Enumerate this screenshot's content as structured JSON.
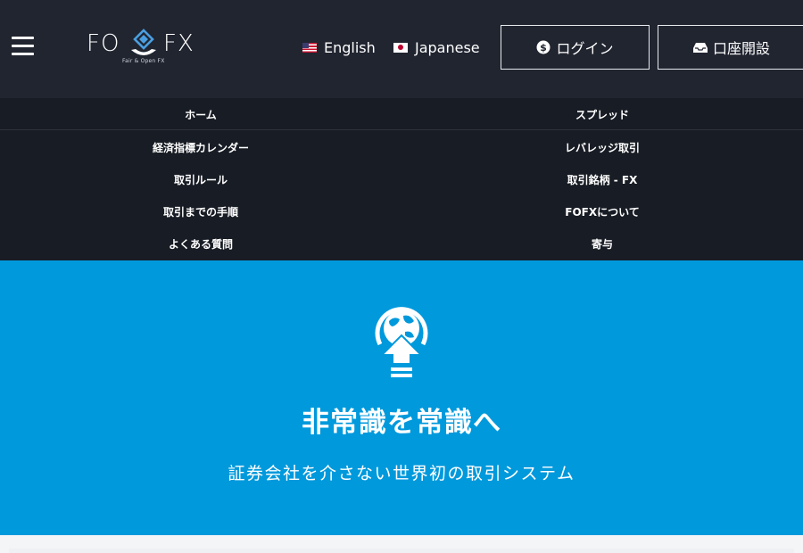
{
  "header": {
    "logo": {
      "left": "FO",
      "right": "FX",
      "tagline": "Fair & Open FX"
    },
    "languages": [
      {
        "label": "English",
        "flag": "us-flag-icon"
      },
      {
        "label": "Japanese",
        "flag": "jp-flag-icon"
      }
    ],
    "login_label": "ログイン",
    "open_account_label": "口座開設"
  },
  "nav": {
    "items": [
      {
        "left": "ホーム",
        "right": "スプレッド"
      },
      {
        "left": "経済指標カレンダー",
        "right": "レバレッジ取引"
      },
      {
        "left": "取引ルール",
        "right": "取引銘柄 - FX"
      },
      {
        "left": "取引までの手順",
        "right": "FOFXについて"
      },
      {
        "left": "よくある質問",
        "right": "寄与"
      }
    ]
  },
  "hero": {
    "icon": "globe-arrow-up-icon",
    "title": "非常識を常識へ",
    "subtitle": "証券会社を介さない世界初の取引システム"
  },
  "colors": {
    "header_bg": "#212530",
    "nav_bg": "#181c24",
    "hero_bg": "#0099dc"
  }
}
